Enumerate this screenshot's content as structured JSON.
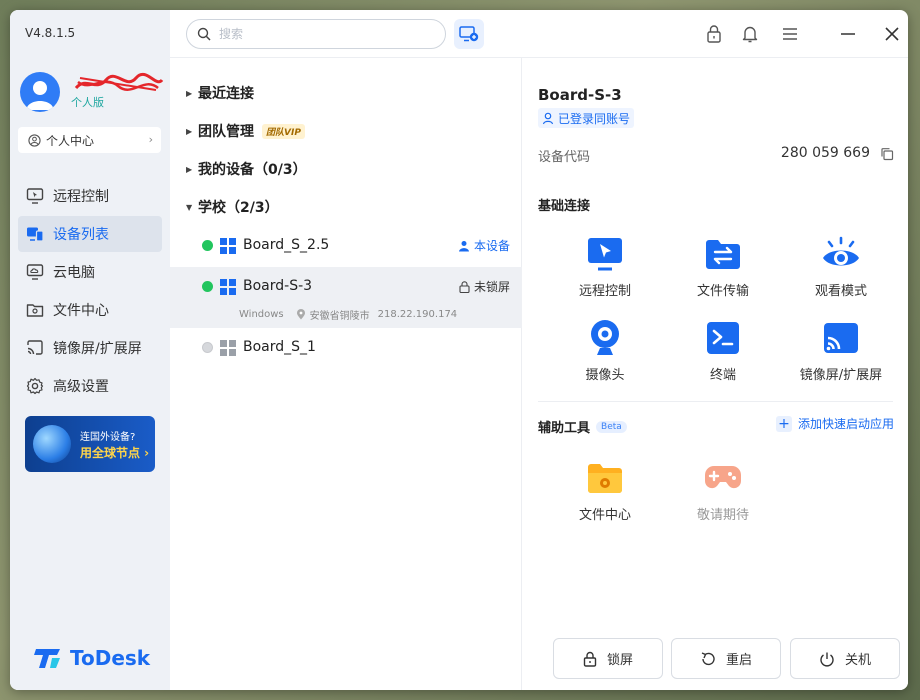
{
  "app": {
    "version": "V4.8.1.5",
    "logo_text": "ToDesk"
  },
  "user": {
    "name": "⇚☑…",
    "edition": "个人版",
    "center_label": "个人中心"
  },
  "sidebar": {
    "items": [
      {
        "label": "远程控制",
        "icon": "monitor-cursor-icon"
      },
      {
        "label": "设备列表",
        "icon": "device-list-icon"
      },
      {
        "label": "云电脑",
        "icon": "cloud-pc-icon"
      },
      {
        "label": "文件中心",
        "icon": "folder-icon"
      },
      {
        "label": "镜像屏/扩展屏",
        "icon": "cast-icon"
      },
      {
        "label": "高级设置",
        "icon": "gear-icon"
      }
    ],
    "active_index": 1,
    "promo": {
      "line1": "连国外设备?",
      "line2": "用全球节点 ›"
    }
  },
  "search": {
    "placeholder": "搜索",
    "value": ""
  },
  "tree": {
    "groups": [
      {
        "label": "最近连接"
      },
      {
        "label": "团队管理",
        "badge": "团队VIP"
      },
      {
        "label": "我的设备（0/3）"
      },
      {
        "label": "学校（2/3）"
      }
    ],
    "devices": [
      {
        "name": "Board_S_2.5",
        "online": true,
        "tag": "本设备"
      },
      {
        "name": "Board-S-3",
        "online": true,
        "tag": "未锁屏",
        "os": "Windows",
        "location": "安徽省铜陵市",
        "ip": "218.22.190.174"
      },
      {
        "name": "Board_S_1",
        "online": false
      }
    ]
  },
  "detail": {
    "title": "Board-S-3",
    "same_account": "已登录同账号",
    "code_label": "设备代码",
    "code_value": "280 059 669",
    "basic_title": "基础连接",
    "basic": [
      {
        "label": "远程控制",
        "icon": "remote-control-icon"
      },
      {
        "label": "文件传输",
        "icon": "file-transfer-icon"
      },
      {
        "label": "观看模式",
        "icon": "eye-icon"
      },
      {
        "label": "摄像头",
        "icon": "camera-icon"
      },
      {
        "label": "终端",
        "icon": "terminal-icon"
      },
      {
        "label": "镜像屏/扩展屏",
        "icon": "cast-icon"
      }
    ],
    "tools_title": "辅助工具",
    "tools_badge": "Beta",
    "add_quick": "添加快速启动应用",
    "tools": [
      {
        "label": "文件中心",
        "icon": "folder-gear-icon"
      },
      {
        "label": "敬请期待",
        "icon": "gamepad-icon"
      }
    ],
    "actions": {
      "lock": "锁屏",
      "restart": "重启",
      "shutdown": "关机"
    }
  },
  "colors": {
    "accent": "#1a6bf0",
    "online": "#22c55e",
    "sidebar_bg": "#eef1f6"
  }
}
